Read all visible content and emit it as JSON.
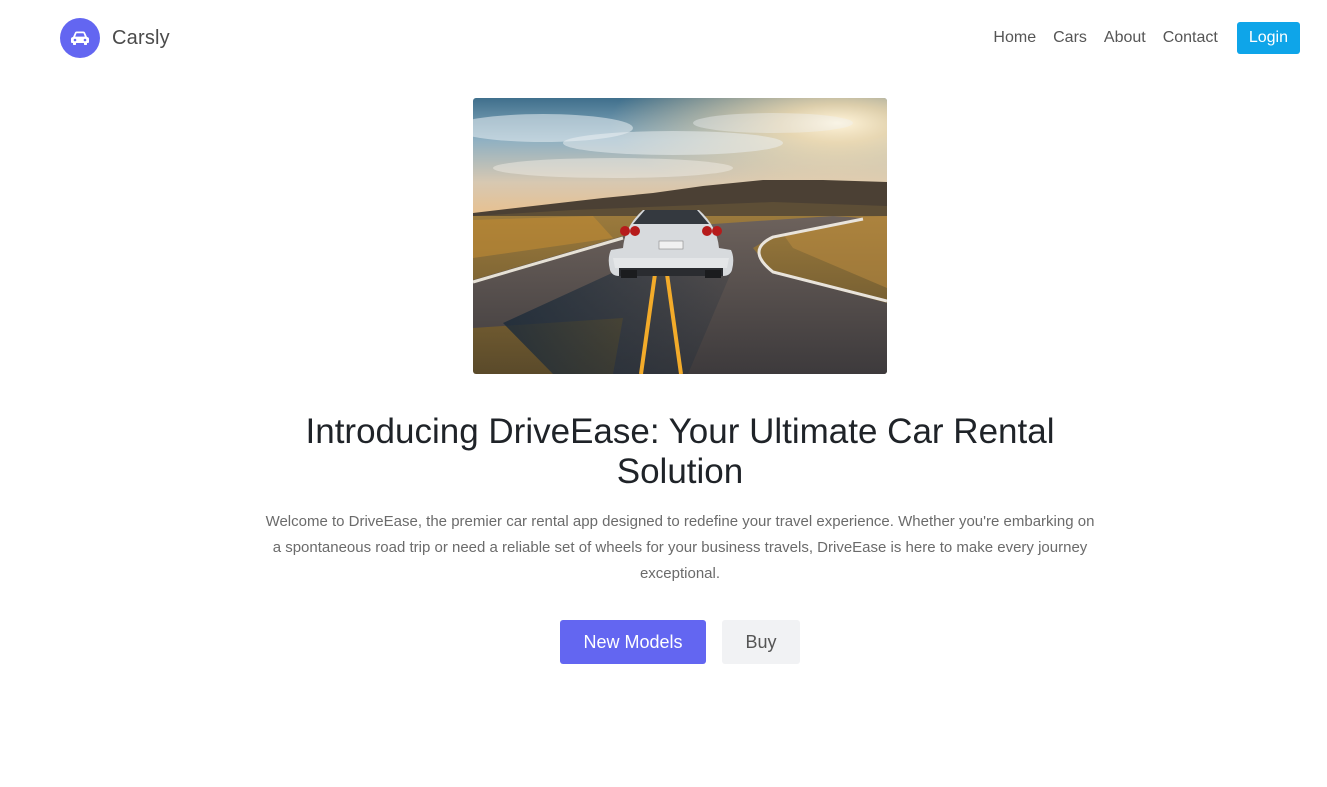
{
  "brand": {
    "name": "Carsly",
    "logo_icon": "car-icon",
    "logo_color": "#6366f1"
  },
  "nav": {
    "links": [
      "Home",
      "Cars",
      "About",
      "Contact"
    ],
    "login_label": "Login",
    "login_color": "#0ea5e9"
  },
  "hero": {
    "image_icon": "car-on-road-image",
    "title": "Introducing DriveEase: Your Ultimate Car Rental Solution",
    "description": "Welcome to DriveEase, the premier car rental app designed to redefine your travel experience. Whether you're embarking on a spontaneous road trip or need a reliable set of wheels for your business travels, DriveEase is here to make every journey exceptional.",
    "primary_button": "New Models",
    "secondary_button": "Buy",
    "primary_color": "#6366f1"
  }
}
